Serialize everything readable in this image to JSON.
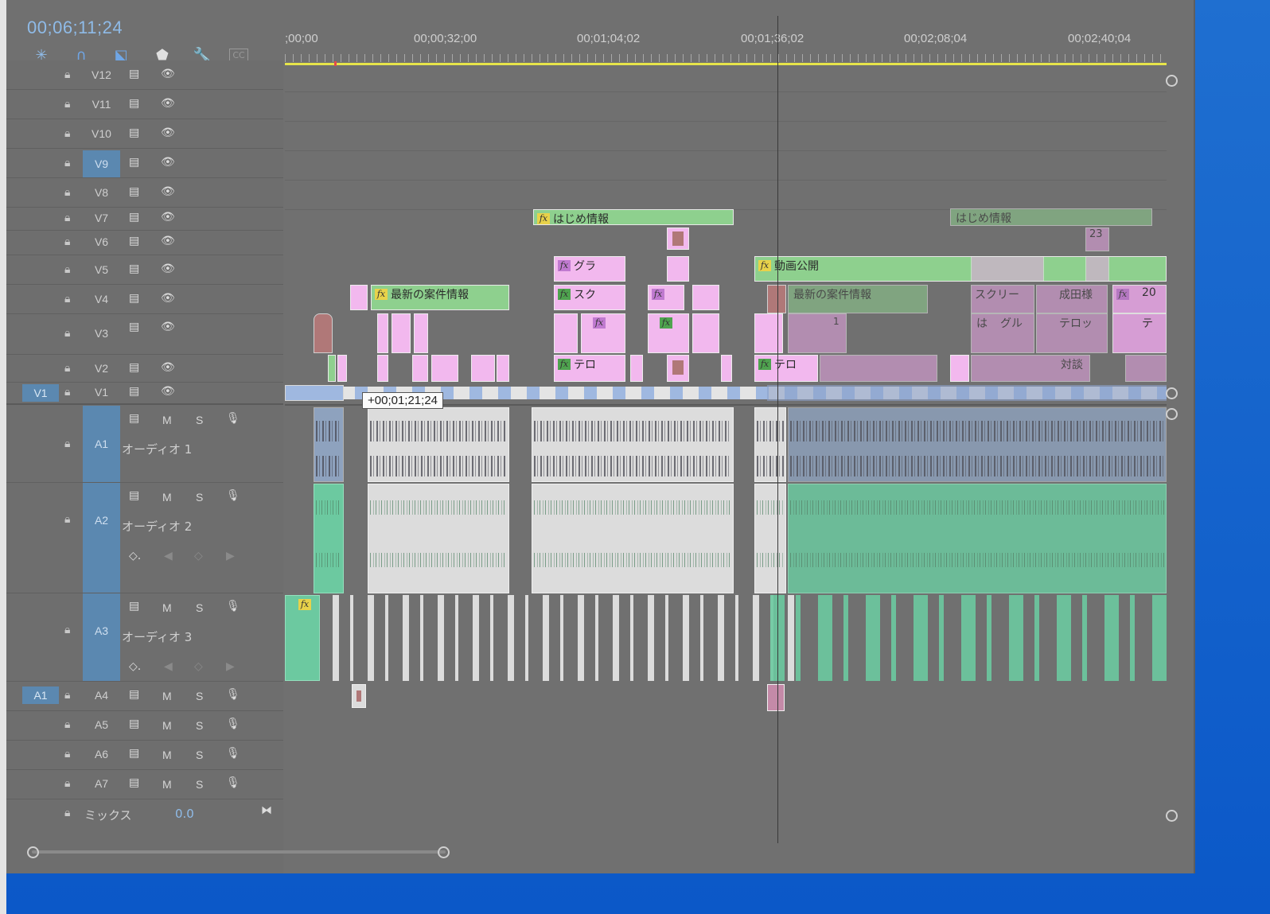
{
  "timecode": "00;06;11;24",
  "tools": {
    "snap": "snap-icon",
    "linked": "linked-selection-icon",
    "marker": "add-marker-icon",
    "settings": "wrench-icon",
    "captions": "CC"
  },
  "ruler": {
    "labels": [
      ";00;00",
      "00;00;32;00",
      "00;01;04;02",
      "00;01;36;02",
      "00;02;08;04",
      "00;02;40;04"
    ]
  },
  "tooltip": "+00;01;21;24",
  "video_tracks": [
    {
      "name": "V12"
    },
    {
      "name": "V11"
    },
    {
      "name": "V10"
    },
    {
      "name": "V9"
    },
    {
      "name": "V8"
    },
    {
      "name": "V7"
    },
    {
      "name": "V6"
    },
    {
      "name": "V5"
    },
    {
      "name": "V4"
    },
    {
      "name": "V3"
    },
    {
      "name": "V2"
    },
    {
      "name": "V1"
    }
  ],
  "video_source": "V1",
  "audio_source": "A1",
  "audio_tracks": [
    {
      "name": "A1",
      "title": "オーディオ 1"
    },
    {
      "name": "A2",
      "title": "オーディオ 2"
    },
    {
      "name": "A3",
      "title": "オーディオ 3"
    },
    {
      "name": "A4"
    },
    {
      "name": "A5"
    },
    {
      "name": "A6"
    },
    {
      "name": "A7"
    }
  ],
  "mute_label": "M",
  "solo_label": "S",
  "mix": {
    "label": "ミックス",
    "value": "0.0"
  },
  "clips": {
    "hajime1": "はじめ情報",
    "hajime2": "はじめ情報",
    "gura": "グラ",
    "douga": "動画公開",
    "saishin1": "最新の案件情報",
    "saishin2": "最新の案件情報",
    "suku": "スク",
    "sukuri": "スクリー",
    "seika": "成田様",
    "n20": "20",
    "n23": "23",
    "tero1": "テロ",
    "tero2": "テロ",
    "taidan": "対談",
    "ha": "は",
    "guru": "グル",
    "terotto": "テロッ",
    "te": "テ",
    "n1": "1"
  },
  "colors": {
    "panel": "#707070",
    "accent": "#5b88b0",
    "timecode": "#8fbbe8",
    "playhead_bar": "#e6e44a",
    "title_clip": "#8ed08e",
    "pink_clip": "#f2b8ee",
    "audio_green": "#6cc9a0"
  }
}
